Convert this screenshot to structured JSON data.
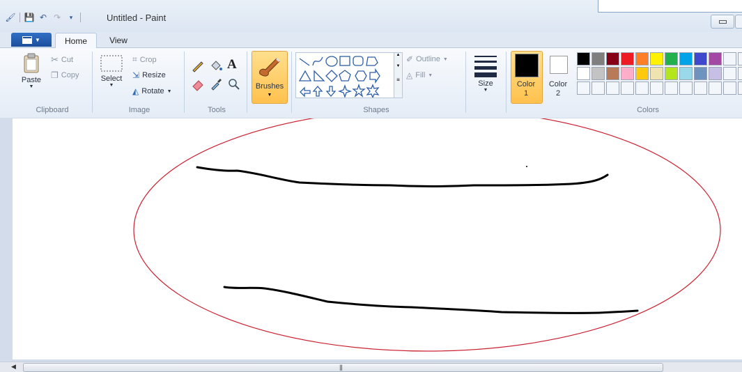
{
  "window": {
    "title": "Untitled - Paint"
  },
  "tabs": {
    "file_icon": "file-menu-icon",
    "home": "Home",
    "view": "View"
  },
  "clipboard": {
    "paste": "Paste",
    "cut": "Cut",
    "copy": "Copy",
    "label": "Clipboard"
  },
  "image": {
    "select": "Select",
    "crop": "Crop",
    "resize": "Resize",
    "rotate": "Rotate",
    "label": "Image"
  },
  "tools": {
    "label": "Tools"
  },
  "brushes": {
    "label": "Brushes"
  },
  "shapes": {
    "outline": "Outline",
    "fill": "Fill",
    "label": "Shapes"
  },
  "size": {
    "label": "Size"
  },
  "colors": {
    "color1_line1": "Color",
    "color1_line2": "1",
    "color2_line1": "Color",
    "color2_line2": "2",
    "label": "Colors",
    "color1_value": "#000000",
    "color2_value": "#ffffff",
    "palette_row1": [
      "#000000",
      "#7f7f7f",
      "#880015",
      "#ed1c24",
      "#ff7f27",
      "#fff200",
      "#22b14c",
      "#00a2e8",
      "#3f48cc",
      "#a349a4",
      "",
      "",
      ""
    ],
    "palette_row2": [
      "#ffffff",
      "#c3c3c3",
      "#b97a57",
      "#ffaec9",
      "#ffc90e",
      "#efe4b0",
      "#b5e61d",
      "#99d9ea",
      "#7092be",
      "#c8bfe7",
      "",
      "",
      ""
    ],
    "palette_row3": [
      "",
      "",
      "",
      "",
      "",
      "",
      "",
      "",
      "",
      "",
      "",
      "",
      ""
    ]
  },
  "annotation": {
    "ellipse_color": "#cc2030",
    "stroke_color": "#000000"
  }
}
